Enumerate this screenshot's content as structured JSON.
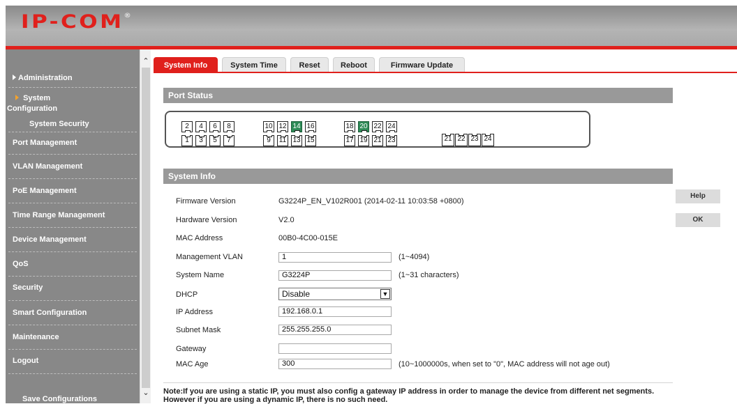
{
  "header": {
    "logo_text": "IP-COM",
    "logo_mark": "®"
  },
  "sidebar": {
    "items": [
      {
        "label": "Administration"
      },
      {
        "label": "System"
      },
      {
        "label": "Configuration"
      },
      {
        "label": "System Security"
      },
      {
        "label": "Port Management"
      },
      {
        "label": "VLAN Management"
      },
      {
        "label": "PoE Management"
      },
      {
        "label": "Time Range Management"
      },
      {
        "label": "Device Management"
      },
      {
        "label": "QoS"
      },
      {
        "label": "Security"
      },
      {
        "label": "Smart Configuration"
      },
      {
        "label": "Maintenance"
      },
      {
        "label": "Logout"
      },
      {
        "label": "Save Configurations"
      }
    ]
  },
  "scrollbar": {
    "up_glyph": "⌃",
    "down_glyph": "⌄"
  },
  "tabs": [
    {
      "label": "System Info",
      "active": true
    },
    {
      "label": "System Time",
      "active": false
    },
    {
      "label": "Reset",
      "active": false
    },
    {
      "label": "Reboot",
      "active": false
    },
    {
      "label": "Firmware Update",
      "active": false
    }
  ],
  "port_status": {
    "title": "Port Status",
    "top_row": [
      "2",
      "4",
      "6",
      "8",
      "10",
      "12",
      "14",
      "16",
      "18",
      "20",
      "22",
      "24"
    ],
    "bottom_row": [
      "1",
      "3",
      "5",
      "7",
      "9",
      "11",
      "13",
      "15",
      "17",
      "19",
      "21",
      "23"
    ],
    "sfp_ports": [
      "21",
      "22",
      "23",
      "24"
    ],
    "active_ports": [
      "14",
      "20"
    ],
    "active_color": "#2e8b57"
  },
  "system_info": {
    "title": "System Info",
    "firmware_version_label": "Firmware Version",
    "firmware_version": "G3224P_EN_V102R001 (2014-02-11 10:03:58 +0800)",
    "hardware_version_label": "Hardware Version",
    "hardware_version": "V2.0",
    "mac_address_label": "MAC Address",
    "mac_address": "00B0-4C00-015E",
    "management_vlan_label": "Management VLAN",
    "management_vlan": "1",
    "management_vlan_hint": "(1~4094)",
    "system_name_label": "System Name",
    "system_name": "G3224P",
    "system_name_hint": "(1~31 characters)",
    "dhcp_label": "DHCP",
    "dhcp_value": "Disable",
    "ip_address_label": "IP Address",
    "ip_address": "192.168.0.1",
    "subnet_mask_label": "Subnet Mask",
    "subnet_mask": "255.255.255.0",
    "gateway_label": "Gateway",
    "gateway": "",
    "mac_age_label": "MAC Age",
    "mac_age": "300",
    "mac_age_hint": "(10~1000000s, when set to \"0\", MAC address will not age out)"
  },
  "buttons": {
    "help": "Help",
    "ok": "OK"
  },
  "note": "Note:If you are using a static IP, you must also config a gateway IP address in order to manage the device from different net segments. However if you are using a dynamic IP, there is no such need.",
  "colors": {
    "accent_red": "#e0201c",
    "sidebar_gray": "#888888",
    "section_gray": "#999999",
    "selected_arrow": "#f4a22b"
  }
}
